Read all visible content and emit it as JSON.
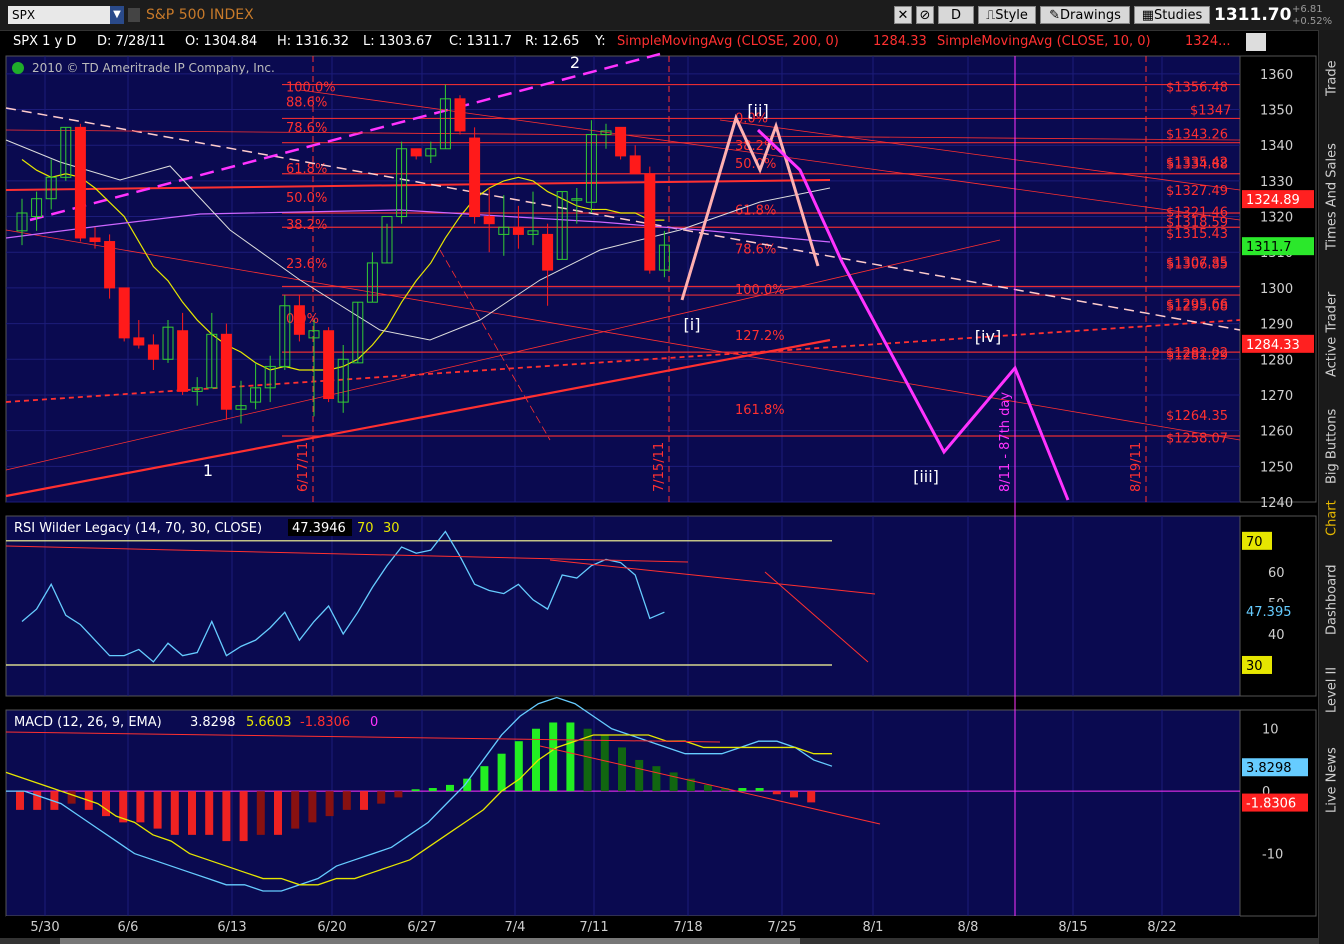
{
  "window": {
    "symbol": "SPX",
    "index_name": "S&P 500 INDEX",
    "period_button": "D",
    "style_label": "Style",
    "drawings_label": "Drawings",
    "studies_label": "Studies",
    "last_price": "1311.70",
    "change": "+6.81",
    "change_pct": "+0.52%"
  },
  "info": {
    "symbol_period": "SPX 1 y D",
    "date": "D: 7/28/11",
    "open": "O: 1304.84",
    "high": "H: 1316.32",
    "low": "L: 1303.67",
    "close": "C: 1311.7",
    "range": "R: 12.65",
    "y": "Y:",
    "sma200": "SimpleMovingAvg (CLOSE, 200, 0)",
    "sma200_val": "1284.33",
    "sma10": "SimpleMovingAvg (CLOSE, 10, 0)",
    "sma10_val": "1324...",
    "copyright": "2010 © TD Ameritrade IP Company, Inc."
  },
  "sidebar_tabs": [
    "Trade",
    "Times And Sales",
    "Active Trader",
    "Big Buttons",
    "Chart",
    "Dashboard",
    "Level II",
    "Live News"
  ],
  "colors": {
    "panel_bg": "#0a0a50",
    "up": "#33cc33",
    "down": "#ff1a1a",
    "fib": "#ff3030",
    "magenta": "#ff33ff",
    "rsi": "#66ccff",
    "signal": "#e6e600",
    "sma10": "#e6e600",
    "sma200": "#cc66ff"
  },
  "chart_data": [
    {
      "type": "candlestick",
      "title": "SPX daily",
      "dates": [
        "5/25",
        "5/26",
        "5/27",
        "5/31",
        "6/1",
        "6/2",
        "6/3",
        "6/6",
        "6/7",
        "6/8",
        "6/9",
        "6/10",
        "6/13",
        "6/14",
        "6/15",
        "6/16",
        "6/17",
        "6/20",
        "6/21",
        "6/22",
        "6/23",
        "6/24",
        "6/27",
        "6/28",
        "6/29",
        "6/30",
        "7/1",
        "7/5",
        "7/6",
        "7/7",
        "7/8",
        "7/11",
        "7/12",
        "7/13",
        "7/14",
        "7/15",
        "7/18",
        "7/19",
        "7/20",
        "7/21",
        "7/22",
        "7/25",
        "7/26",
        "7/27",
        "7/28"
      ],
      "open": [
        1316,
        1320,
        1325,
        1331,
        1345,
        1314,
        1313,
        1300,
        1286,
        1284,
        1280,
        1288,
        1271,
        1272,
        1287,
        1266,
        1268,
        1272,
        1278,
        1295,
        1286,
        1288,
        1268,
        1279,
        1296,
        1307,
        1320,
        1339,
        1337,
        1339,
        1353,
        1342,
        1320,
        1315,
        1317,
        1315,
        1315,
        1308,
        1325,
        1324,
        1343,
        1345,
        1337,
        1332,
        1305
      ],
      "high": [
        1325,
        1327,
        1336,
        1345,
        1346,
        1317,
        1315,
        1300,
        1291,
        1287,
        1291,
        1293,
        1275,
        1293,
        1290,
        1274,
        1279,
        1281,
        1298,
        1298,
        1291,
        1289,
        1284,
        1296,
        1310,
        1318,
        1341,
        1339,
        1341,
        1357,
        1354,
        1345,
        1328,
        1326,
        1323,
        1327,
        1318,
        1327,
        1328,
        1347,
        1346,
        1345,
        1340,
        1334,
        1316
      ],
      "low": [
        1312,
        1316,
        1322,
        1330,
        1313,
        1311,
        1297,
        1285,
        1283,
        1277,
        1279,
        1270,
        1267,
        1272,
        1263,
        1262,
        1266,
        1268,
        1277,
        1285,
        1264,
        1268,
        1265,
        1279,
        1296,
        1307,
        1318,
        1336,
        1335,
        1339,
        1343,
        1318,
        1310,
        1309,
        1311,
        1312,
        1295,
        1308,
        1318,
        1321,
        1339,
        1336,
        1336,
        1304,
        1303
      ],
      "close": [
        1321,
        1325,
        1331,
        1345,
        1314,
        1313,
        1300,
        1286,
        1284,
        1280,
        1289,
        1271,
        1272,
        1287,
        1266,
        1267,
        1272,
        1278,
        1295,
        1287,
        1288,
        1269,
        1280,
        1296,
        1307,
        1320,
        1339,
        1337,
        1339,
        1353,
        1344,
        1320,
        1318,
        1317,
        1315,
        1316,
        1305,
        1327,
        1325,
        1343,
        1344,
        1337,
        1332,
        1305,
        1312
      ],
      "sma10": [
        1336,
        1333,
        1331,
        1332,
        1331,
        1328,
        1324,
        1320,
        1313,
        1306,
        1302,
        1296,
        1291,
        1287,
        1284,
        1282,
        1279,
        1277,
        1278,
        1277,
        1277,
        1277,
        1278,
        1280,
        1284,
        1289,
        1296,
        1302,
        1307,
        1314,
        1320,
        1325,
        1328,
        1330,
        1331,
        1330,
        1327,
        1325,
        1323,
        1322,
        1322,
        1321,
        1321,
        1319,
        1319
      ],
      "ylim": [
        1240,
        1365
      ],
      "y_ticks": [
        1240,
        1250,
        1260,
        1270,
        1280,
        1290,
        1300,
        1310,
        1320,
        1330,
        1340,
        1350,
        1360
      ],
      "x_ticks": [
        "5/30",
        "6/6",
        "6/13",
        "6/20",
        "6/27",
        "7/4",
        "7/11",
        "7/18",
        "7/25",
        "8/1",
        "8/8",
        "8/15",
        "8/22"
      ],
      "fib_levels": [
        "100.0%",
        "88.6%",
        "78.6%",
        "61.8%",
        "50.0%",
        "38.2%",
        "23.6%",
        "0.0%"
      ],
      "fib_levels_2": [
        "0.0%",
        "38.2%",
        "50.0%",
        "61.8%",
        "78.6%",
        "100.0%",
        "127.2%",
        "161.8%"
      ],
      "price_labels": [
        "$1356.48",
        "$1347",
        "$1343.26",
        "$1335.42",
        "$1334.88",
        "$1327.49",
        "$1321.46",
        "$1318.59",
        "$1315.43",
        "$1307.35",
        "$1306.85",
        "$1295.66",
        "$1295.08",
        "$1282.02",
        "$1281.29",
        "$1264.35",
        "$1258.07"
      ],
      "axis_flags": [
        {
          "value": 1324.89,
          "label": "1324.89",
          "color": "#ff2020"
        },
        {
          "value": 1311.7,
          "label": "1311.7",
          "color": "#2be82b"
        },
        {
          "value": 1284.33,
          "label": "1284.33",
          "color": "#ff2020"
        }
      ],
      "wave_labels": [
        "1",
        "2",
        "[i]",
        "[ii]",
        "[iii]",
        "[iv]"
      ],
      "date_markers": [
        "6/17/11",
        "7/15/11",
        "8/11 - 87th day",
        "8/19/11"
      ]
    },
    {
      "type": "line",
      "title": "RSI Wilder Legacy (14, 70, 30, CLOSE)",
      "current": "47.3946",
      "overbought": "70",
      "oversold": "30",
      "values": [
        44,
        48,
        56,
        46,
        43,
        38,
        33,
        33,
        35,
        31,
        37,
        33,
        34,
        44,
        33,
        36,
        38,
        42,
        47,
        38,
        44,
        49,
        40,
        47,
        55,
        62,
        68,
        66,
        67,
        73,
        65,
        56,
        54,
        53,
        56,
        51,
        48,
        59,
        58,
        62,
        64,
        63,
        59,
        45,
        47
      ],
      "ylim": [
        20,
        78
      ],
      "y_ticks": [
        40,
        50,
        60
      ],
      "flag": "47.395"
    },
    {
      "type": "bar",
      "title": "MACD (12, 26, 9, EMA)",
      "macd": "3.8298",
      "signal": "5.6603",
      "hist_label": "-1.8306",
      "zero": "0",
      "hist": [
        -3,
        -3,
        -3,
        -2,
        -3,
        -4,
        -5,
        -5,
        -6,
        -7,
        -7,
        -7,
        -8,
        -8,
        -7,
        -7,
        -6,
        -5,
        -4,
        -3,
        -3,
        -2,
        -1,
        0.3,
        0.5,
        1,
        2,
        4,
        6,
        8,
        10,
        11,
        11,
        10,
        9,
        7,
        5,
        4,
        3,
        2,
        1,
        0.5,
        0.5,
        0.5,
        -0.5,
        -1,
        -1.8
      ],
      "macd_line": [
        0,
        0,
        -1,
        -2,
        -4,
        -6,
        -8,
        -10,
        -11,
        -12,
        -13,
        -14,
        -15,
        -15,
        -16,
        -16,
        -15,
        -14,
        -12,
        -11,
        -10,
        -9,
        -7,
        -5,
        -2,
        1,
        5,
        9,
        12,
        14,
        15,
        14,
        12,
        10,
        9,
        8,
        7,
        6,
        6,
        6,
        7,
        8,
        8,
        7,
        5,
        4
      ],
      "signal_line": [
        3,
        2,
        1,
        0,
        -1,
        -2,
        -4,
        -5,
        -7,
        -8,
        -10,
        -11,
        -12,
        -13,
        -14,
        -14,
        -15,
        -15,
        -14,
        -14,
        -13,
        -12,
        -11,
        -9,
        -7,
        -5,
        -3,
        0,
        2,
        5,
        7,
        8,
        9,
        9,
        9,
        9,
        8,
        8,
        7,
        7,
        7,
        7,
        7,
        7,
        6,
        6
      ],
      "ylim": [
        -20,
        13
      ],
      "y_ticks": [
        10,
        0,
        -10
      ],
      "flags": [
        {
          "label": "3.8298",
          "color": "#66ccff",
          "value": 3.83
        },
        {
          "label": "-1.8306",
          "color": "#ff2020",
          "value": -1.83
        }
      ]
    }
  ]
}
